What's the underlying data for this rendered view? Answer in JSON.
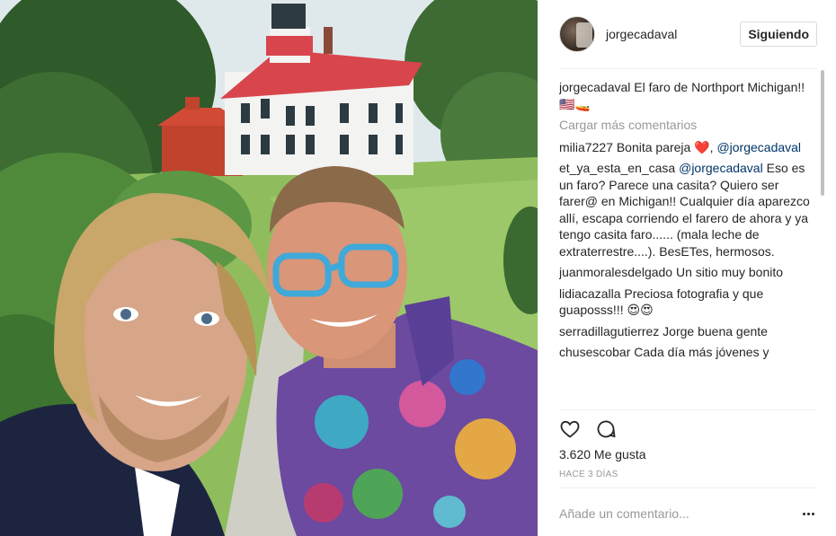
{
  "post": {
    "username": "jorgecadaval",
    "follow_label": "Siguiendo",
    "photo_alt": "Selfie de dos hombres frente al faro de Northport",
    "caption": {
      "author": "jorgecadaval",
      "text": " El faro de Northport Michigan!! 🇺🇸🚤"
    },
    "load_more_label": "Cargar más comentarios",
    "comments": [
      {
        "author": "milia7227",
        "text": " Bonita pareja ❤️, ",
        "mention": "@jorgecadaval",
        "after": ""
      },
      {
        "author": "et_ya_esta_en_casa",
        "text": " ",
        "mention": "@jorgecadaval",
        "after": " Eso es un faro? Parece una casita? Quiero ser farer@ en Michigan!! Cualquier día aparezco allí, escapa corriendo el farero de ahora y ya tengo casita faro...... (mala leche de extraterrestre....). BesETes, hermosos."
      },
      {
        "author": "juanmoralesdelgado",
        "text": " Un sitio muy bonito",
        "mention": "",
        "after": ""
      },
      {
        "author": "lidiacazalla",
        "text": " Preciosa fotografia y que guaposss!!! 😍😍",
        "mention": "",
        "after": ""
      },
      {
        "author": "serradillagutierrez",
        "text": " Jorge buena gente",
        "mention": "",
        "after": ""
      },
      {
        "author": "chusescobar",
        "text": " Cada día más jóvenes y",
        "mention": "",
        "after": ""
      }
    ],
    "likes": "3.620 Me gusta",
    "timestamp": "HACE 3 DÍAS",
    "comment_placeholder": "Añade un comentario...",
    "icons": {
      "like": "heart-icon",
      "comment": "comment-bubble-icon",
      "more": "more-options-icon"
    }
  }
}
